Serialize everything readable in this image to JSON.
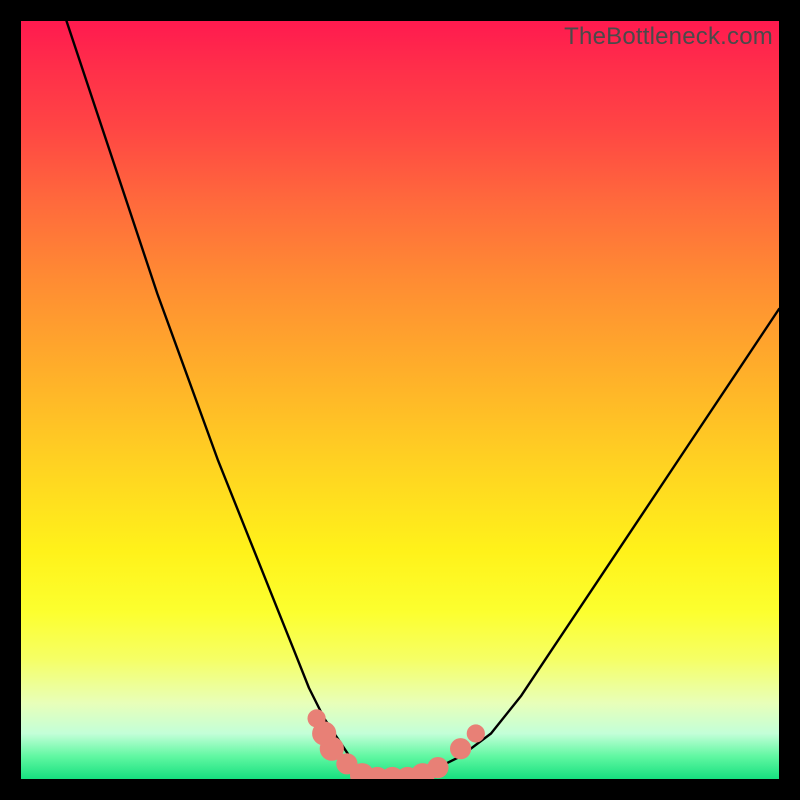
{
  "watermark": "TheBottleneck.com",
  "chart_data": {
    "type": "line",
    "title": "",
    "xlabel": "",
    "ylabel": "",
    "xlim": [
      0,
      100
    ],
    "ylim": [
      0,
      100
    ],
    "series": [
      {
        "name": "bottleneck-curve",
        "x": [
          6,
          10,
          14,
          18,
          22,
          26,
          30,
          34,
          36,
          38,
          40,
          42,
          44,
          46,
          48,
          50,
          54,
          58,
          62,
          66,
          70,
          76,
          82,
          88,
          94,
          100
        ],
        "y": [
          100,
          88,
          76,
          64,
          53,
          42,
          32,
          22,
          17,
          12,
          8,
          5,
          2,
          0,
          0,
          0,
          1,
          3,
          6,
          11,
          17,
          26,
          35,
          44,
          53,
          62
        ]
      }
    ],
    "markers": {
      "name": "highlight-dots",
      "color": "#e88076",
      "points": [
        {
          "x": 39,
          "y": 8,
          "r": 1.2
        },
        {
          "x": 40,
          "y": 6,
          "r": 1.6
        },
        {
          "x": 41,
          "y": 4,
          "r": 1.6
        },
        {
          "x": 43,
          "y": 2,
          "r": 1.4
        },
        {
          "x": 45,
          "y": 0.5,
          "r": 1.6
        },
        {
          "x": 47,
          "y": 0,
          "r": 1.6
        },
        {
          "x": 49,
          "y": 0,
          "r": 1.6
        },
        {
          "x": 51,
          "y": 0,
          "r": 1.6
        },
        {
          "x": 53,
          "y": 0.5,
          "r": 1.6
        },
        {
          "x": 55,
          "y": 1.5,
          "r": 1.4
        },
        {
          "x": 58,
          "y": 4,
          "r": 1.4
        },
        {
          "x": 60,
          "y": 6,
          "r": 1.2
        }
      ]
    },
    "background_gradient": {
      "top": "#ff1a4f",
      "mid": "#fff21a",
      "bottom": "#16e07f"
    }
  }
}
